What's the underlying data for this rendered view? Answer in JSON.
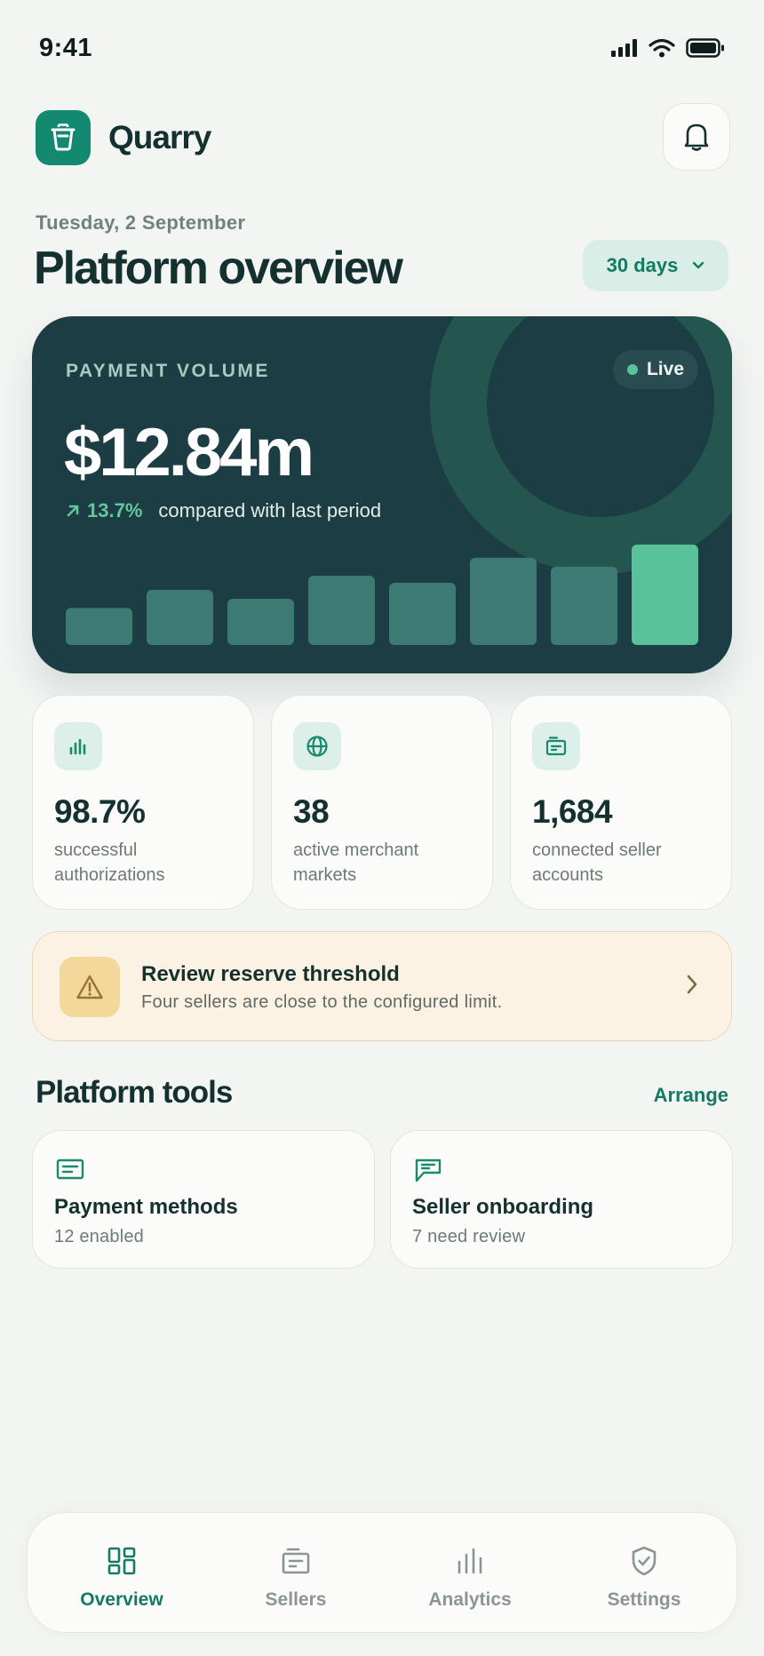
{
  "status_bar": {
    "time": "9:41"
  },
  "header": {
    "app_name": "Quarry"
  },
  "overview": {
    "date": "Tuesday, 2 September",
    "title": "Platform overview",
    "period": "30 days"
  },
  "volume_card": {
    "label": "PAYMENT VOLUME",
    "live_label": "Live",
    "value": "$12.84m",
    "change": "13.7%",
    "change_text": "compared with last period",
    "bar_levels": [
      0.37,
      0.55,
      0.46,
      0.69,
      0.62,
      0.87,
      0.78,
      1.0
    ],
    "colors": {
      "bar": "#3d7a73",
      "bar_highlight": "#59c29a",
      "card_bg": "#1b3d43"
    }
  },
  "stats": [
    {
      "value": "98.7%",
      "label": "successful authorizations",
      "icon": "bar-chart-icon"
    },
    {
      "value": "38",
      "label": "active merchant markets",
      "icon": "globe-icon"
    },
    {
      "value": "1,684",
      "label": "connected seller accounts",
      "icon": "accounts-icon"
    }
  ],
  "alert": {
    "title": "Review reserve threshold",
    "text": "Four sellers are close to the configured limit.",
    "icon": "warning-icon"
  },
  "tools": {
    "title": "Platform tools",
    "action": "Arrange",
    "items": [
      {
        "name": "Payment methods",
        "sub": "12 enabled",
        "icon": "payment-methods-icon"
      },
      {
        "name": "Seller onboarding",
        "sub": "7 need review",
        "icon": "onboarding-icon"
      }
    ]
  },
  "nav": {
    "items": [
      {
        "label": "Overview",
        "icon": "dashboard-icon",
        "active": true
      },
      {
        "label": "Sellers",
        "icon": "sellers-icon",
        "active": false
      },
      {
        "label": "Analytics",
        "icon": "analytics-icon",
        "active": false
      },
      {
        "label": "Settings",
        "icon": "shield-icon",
        "active": false
      }
    ]
  },
  "colors": {
    "accent": "#157a63",
    "brand": "#138a6f",
    "background": "#f3f5f3"
  }
}
